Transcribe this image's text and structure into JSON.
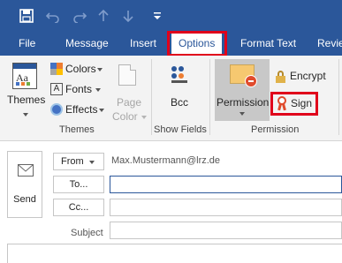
{
  "qat": {
    "save": "save-icon",
    "undo": "undo-icon",
    "redo": "redo-icon",
    "up": "up-arrow-icon",
    "down": "down-arrow-icon",
    "customize": "customize-qat-icon"
  },
  "tabs": [
    {
      "label": "File",
      "active": false
    },
    {
      "label": "Message",
      "active": false
    },
    {
      "label": "Insert",
      "active": false
    },
    {
      "label": "Options",
      "active": true
    },
    {
      "label": "Format Text",
      "active": false
    },
    {
      "label": "Revie",
      "active": false
    }
  ],
  "ribbon": {
    "themes_group": {
      "label": "Themes",
      "themes_button": "Themes",
      "colors": "Colors",
      "fonts": "Fonts",
      "effects": "Effects",
      "page_color_line1": "Page",
      "page_color_line2": "Color"
    },
    "show_fields_group": {
      "label": "Show Fields",
      "bcc": "Bcc"
    },
    "permission_group": {
      "label": "Permission",
      "permission": "Permission",
      "encrypt": "Encrypt",
      "sign": "Sign"
    }
  },
  "compose": {
    "send": "Send",
    "from_button": "From",
    "from_address": "Max.Mustermann@lrz.de",
    "to_button": "To...",
    "to_value": "",
    "cc_button": "Cc...",
    "cc_value": "",
    "subject_label": "Subject",
    "subject_value": ""
  },
  "colors": {
    "titlebar": "#2b579a",
    "highlight": "#e0001b",
    "ribbon_bg": "#f3f3f3"
  }
}
